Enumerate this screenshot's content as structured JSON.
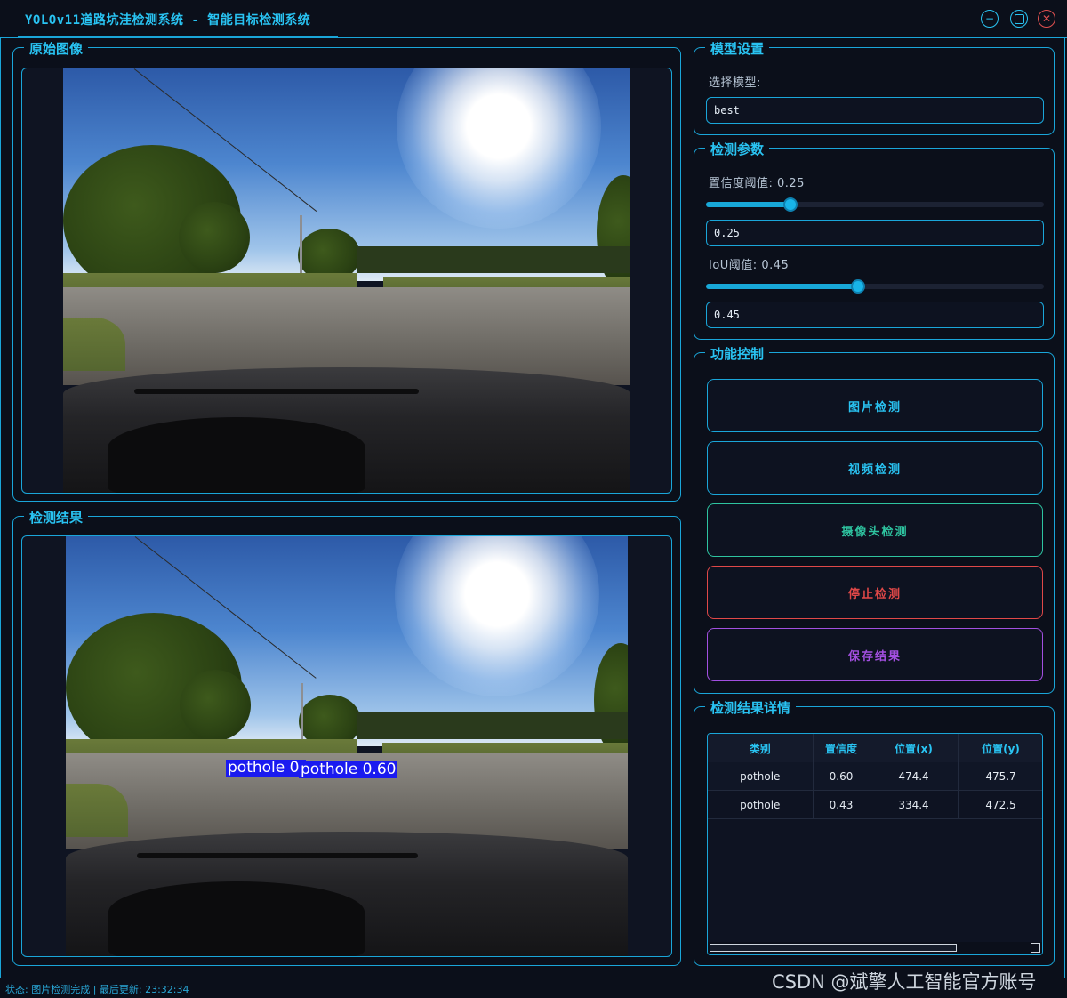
{
  "window": {
    "title": "YOLOv11道路坑洼检测系统 - 智能目标检测系统",
    "controls": [
      "minimize-icon",
      "maximize-icon",
      "close-icon"
    ]
  },
  "panels": {
    "original_title": "原始图像",
    "result_title": "检测结果"
  },
  "detections_overlay": [
    "pothole 0.",
    "pothole 0.60"
  ],
  "model": {
    "group_title": "模型设置",
    "select_label": "选择模型:",
    "selected_value": "best"
  },
  "params": {
    "group_title": "检测参数",
    "conf_label": "置信度阈值: 0.25",
    "conf_value": "0.25",
    "conf_fraction": 0.25,
    "iou_label": "IoU阈值: 0.45",
    "iou_value": "0.45",
    "iou_fraction": 0.45
  },
  "controls": {
    "group_title": "功能控制",
    "image_detect": "图片检测",
    "video_detect": "视频检测",
    "camera_detect": "摄像头检测",
    "stop_detect": "停止检测",
    "save_results": "保存结果"
  },
  "details": {
    "group_title": "检测结果详情",
    "columns": [
      "类别",
      "置信度",
      "位置(x)",
      "位置(y)"
    ],
    "rows": [
      [
        "pothole",
        "0.60",
        "474.4",
        "475.7"
      ],
      [
        "pothole",
        "0.43",
        "334.4",
        "472.5"
      ]
    ]
  },
  "status_bar": "状态: 图片检测完成 | 最后更新: 23:32:34",
  "watermark": "CSDN @斌擎人工智能官方账号",
  "colors": {
    "accent": "#29c3f2",
    "border": "#1aa6d9",
    "camera": "#2ec4a0",
    "stop": "#e04848",
    "save": "#a24fe0",
    "detection_box": "#1a1af0"
  }
}
